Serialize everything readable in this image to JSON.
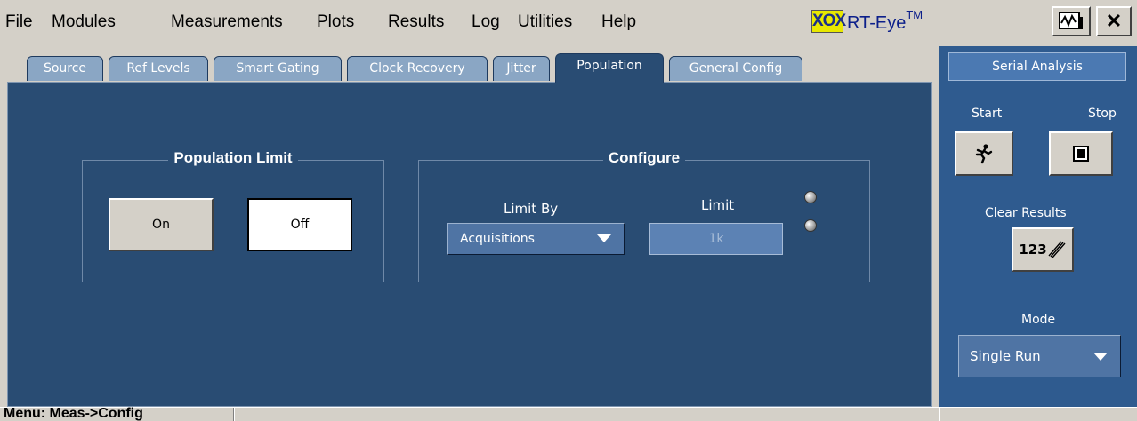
{
  "menubar": {
    "items": [
      "File",
      "Modules",
      "Measurements",
      "Plots",
      "Results",
      "Log",
      "Utilities",
      "Help"
    ],
    "logo_mark": "XOX",
    "logo_text": "RT-Eye",
    "logo_sup": "TM"
  },
  "tabs": [
    "Source",
    "Ref Levels",
    "Smart Gating",
    "Clock Recovery",
    "Jitter",
    "Population",
    "General Config"
  ],
  "active_tab": "Population",
  "population_limit": {
    "title": "Population Limit",
    "on_label": "On",
    "off_label": "Off",
    "selected": "Off"
  },
  "configure": {
    "title": "Configure",
    "limit_by_label": "Limit By",
    "limit_by_value": "Acquisitions",
    "limit_label": "Limit",
    "limit_value": "1k"
  },
  "right_panel": {
    "serial_analysis": "Serial Analysis",
    "start_label": "Start",
    "stop_label": "Stop",
    "clear_results_label": "Clear Results",
    "clear_icon_text": "123",
    "mode_label": "Mode",
    "mode_value": "Single Run"
  },
  "status": {
    "text": "Menu: Meas->Config"
  },
  "colors": {
    "panel_bg": "#294c73",
    "tab_inactive": "#8aa6c4",
    "right_panel_bg": "#2f5b8f",
    "logo_yellow": "#e8e800"
  }
}
